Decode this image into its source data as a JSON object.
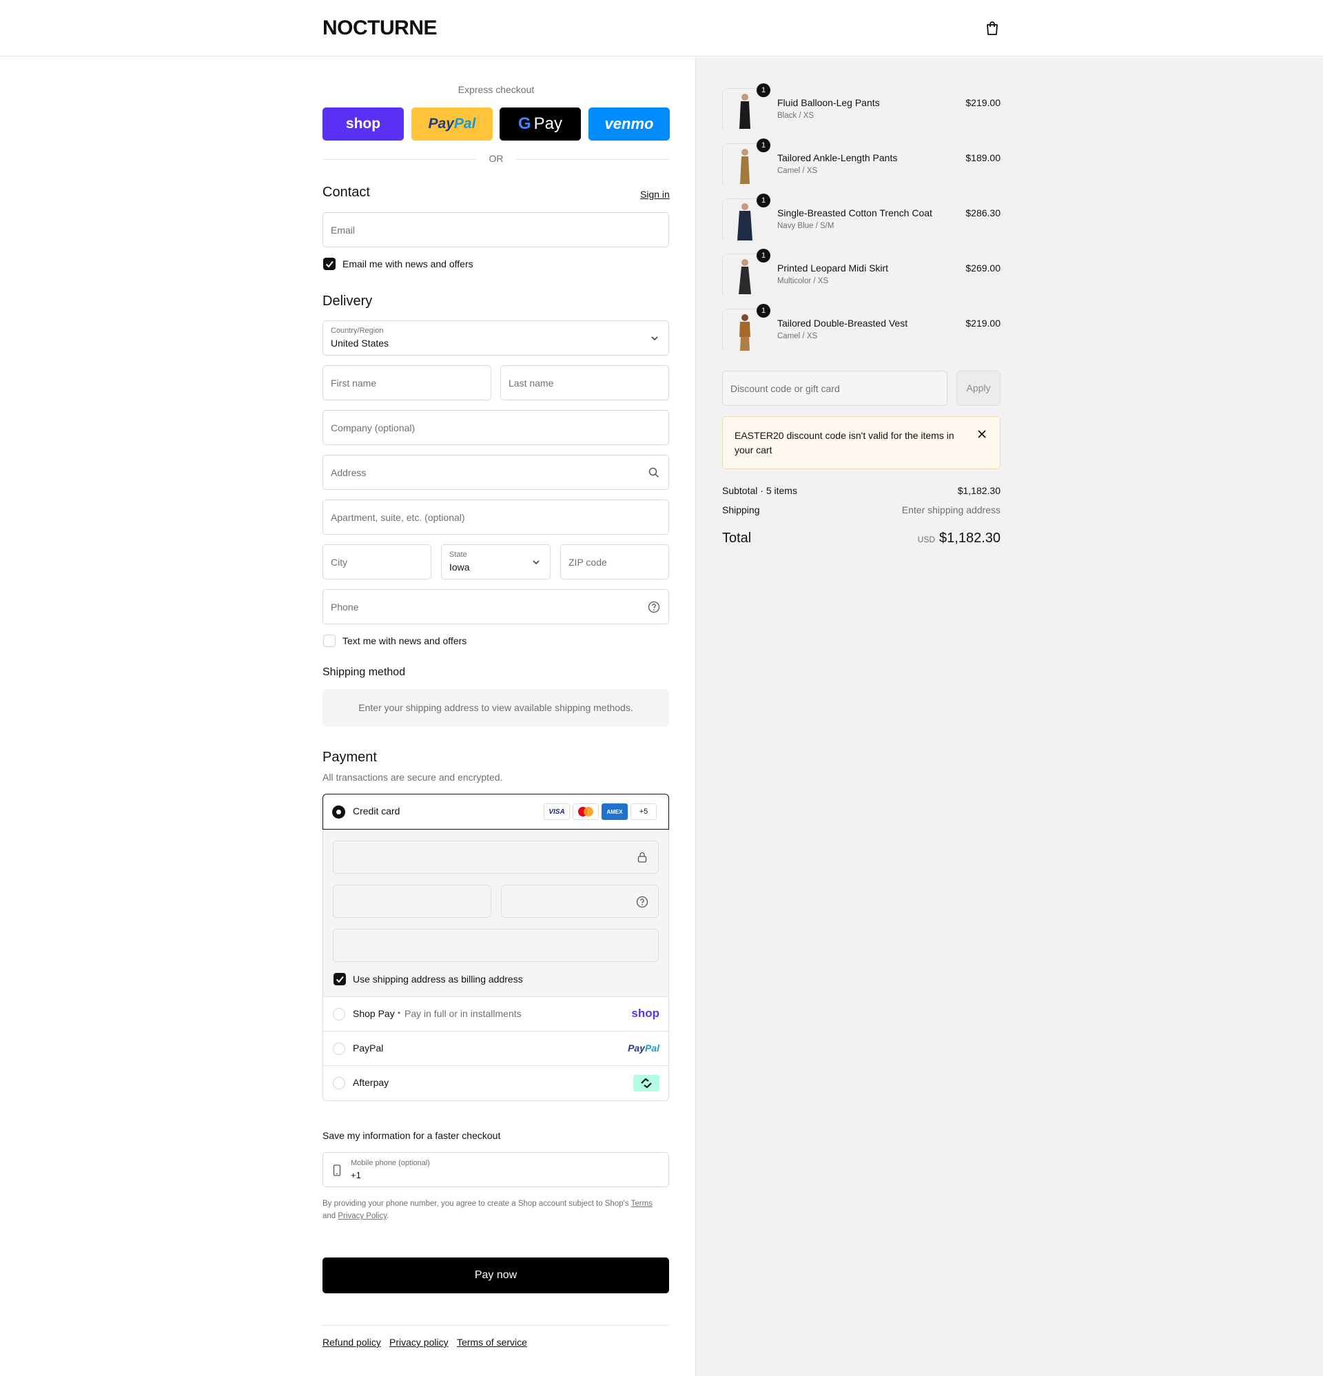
{
  "header": {
    "logo": "NOCTURNE",
    "cart_icon": "shopping-bag-icon"
  },
  "express": {
    "title": "Express checkout",
    "buttons": [
      {
        "label": "shop",
        "bg": "#5a31f4",
        "color": "#ffffff"
      },
      {
        "label_a": "Pay",
        "label_b": "Pal",
        "bg": "#ffc439"
      },
      {
        "label_g": "G",
        "label_pay": "Pay",
        "bg": "#000000"
      },
      {
        "label": "venmo",
        "bg": "#008cff",
        "color": "#ffffff"
      }
    ],
    "or": "OR"
  },
  "contact": {
    "title": "Contact",
    "sign_in": "Sign in",
    "email_placeholder": "Email",
    "newsletter": "Email me with news and offers",
    "newsletter_checked": true
  },
  "delivery": {
    "title": "Delivery",
    "country_label": "Country/Region",
    "country_value": "United States",
    "first_name": "First name",
    "last_name": "Last name",
    "company": "Company (optional)",
    "address": "Address",
    "apartment": "Apartment, suite, etc. (optional)",
    "city": "City",
    "state_label": "State",
    "state_value": "Iowa",
    "zip": "ZIP code",
    "phone": "Phone",
    "sms": "Text me with news and offers",
    "sms_checked": false
  },
  "shipping": {
    "title": "Shipping method",
    "message": "Enter your shipping address to view available shipping methods."
  },
  "payment": {
    "title": "Payment",
    "subtitle": "All transactions are secure and encrypted.",
    "credit_card": "Credit card",
    "card_brands": [
      "VISA",
      "AMEX",
      "+5"
    ],
    "billing_same": "Use shipping address as billing address",
    "shop_pay": "Shop Pay",
    "shop_pay_sep": "•",
    "shop_pay_note": "Pay in full or in installments",
    "shop_pay_logo": "shop",
    "paypal": "PayPal",
    "paypal_logo_a": "Pay",
    "paypal_logo_b": "Pal",
    "afterpay": "Afterpay"
  },
  "save_info": {
    "title": "Save my information for a faster checkout",
    "phone_label": "Mobile phone (optional)",
    "phone_value": "+1",
    "legal_a": "By providing your phone number, you agree to create a Shop account subject to Shop's",
    "terms": "Terms",
    "legal_b": "and",
    "privacy": "Privacy Policy",
    "legal_c": "."
  },
  "pay_now": "Pay now",
  "footer_links": [
    "Refund policy",
    "Privacy policy",
    "Terms of service"
  ],
  "cart": {
    "items": [
      {
        "name": "Fluid Balloon-Leg Pants",
        "variant": "Black / XS",
        "price": "$219.00",
        "qty": "1",
        "color": "#1a1a1a"
      },
      {
        "name": "Tailored Ankle-Length Pants",
        "variant": "Camel / XS",
        "price": "$189.00",
        "qty": "1",
        "color": "#a47a3c"
      },
      {
        "name": "Single-Breasted Cotton Trench Coat",
        "variant": "Navy Blue / S/M",
        "price": "$286.30",
        "qty": "1",
        "color": "#1f2a44"
      },
      {
        "name": "Printed Leopard Midi Skirt",
        "variant": "Multicolor / XS",
        "price": "$269.00",
        "qty": "1",
        "color": "#2b2b2b"
      },
      {
        "name": "Tailored Double-Breasted Vest",
        "variant": "Camel / XS",
        "price": "$219.00",
        "qty": "1",
        "color": "#a5692a"
      }
    ],
    "discount_placeholder": "Discount code or gift card",
    "apply": "Apply",
    "error": "EASTER20 discount code isn't valid for the items in your cart",
    "subtotal_label": "Subtotal · 5 items",
    "subtotal_value": "$1,182.30",
    "shipping_label": "Shipping",
    "shipping_value": "Enter shipping address",
    "total_label": "Total",
    "currency": "USD",
    "total_value": "$1,182.30"
  }
}
